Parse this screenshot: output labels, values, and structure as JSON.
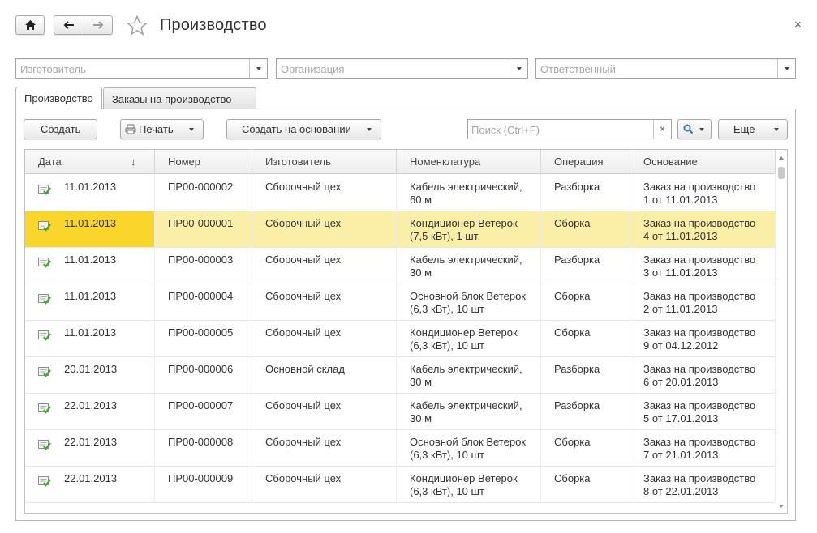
{
  "window": {
    "title": "Производство",
    "close_glyph": "×"
  },
  "icons": {
    "home": "home-icon",
    "back": "arrow-left-icon",
    "forward": "arrow-right-icon",
    "favorite": "star-icon",
    "print": "printer-icon",
    "search": "magnifier-icon",
    "doc": "posted-document-icon"
  },
  "filters": [
    {
      "placeholder": "Изготовитель"
    },
    {
      "placeholder": "Организация"
    },
    {
      "placeholder": "Ответственный"
    }
  ],
  "tabs": [
    {
      "label": "Производство",
      "active": true
    },
    {
      "label": "Заказы на производство",
      "active": false
    }
  ],
  "toolbar": {
    "create_label": "Создать",
    "print_label": "Печать",
    "create_based_label": "Создать на основании",
    "search_placeholder": "Поиск (Ctrl+F)",
    "search_clear": "×",
    "more_label": "Еще"
  },
  "colors": {
    "selected_row": "#fbeea6",
    "selected_cell": "#f9d72a",
    "doc_icon_check": "#3aa829"
  },
  "table": {
    "columns": [
      "Дата",
      "Номер",
      "Изготовитель",
      "Номенклатура",
      "Операция",
      "Основание"
    ],
    "sort_indicator": "↓",
    "selected_index": 1,
    "rows": [
      {
        "date": "11.01.2013",
        "number": "ПР00-000002",
        "maker": "Сборочный цех",
        "item1": "Кабель электрический,",
        "item2": "60 м",
        "operation": "Разборка",
        "basis1": "Заказ на производство",
        "basis2": "1 от 11.01.2013"
      },
      {
        "date": "11.01.2013",
        "number": "ПР00-000001",
        "maker": "Сборочный цех",
        "item1": "Кондиционер Ветерок",
        "item2": "(7,5 кВт), 1 шт",
        "operation": "Сборка",
        "basis1": "Заказ на производство",
        "basis2": "4 от 11.01.2013"
      },
      {
        "date": "11.01.2013",
        "number": "ПР00-000003",
        "maker": "Сборочный цех",
        "item1": "Кабель электрический,",
        "item2": "30 м",
        "operation": "Разборка",
        "basis1": "Заказ на производство",
        "basis2": "3 от 11.01.2013"
      },
      {
        "date": "11.01.2013",
        "number": "ПР00-000004",
        "maker": "Сборочный цех",
        "item1": "Основной блок Ветерок",
        "item2": "(6,3 кВт), 10 шт",
        "operation": "Сборка",
        "basis1": "Заказ на производство",
        "basis2": "2 от 11.01.2013"
      },
      {
        "date": "11.01.2013",
        "number": "ПР00-000005",
        "maker": "Сборочный цех",
        "item1": "Кондиционер Ветерок",
        "item2": "(6,3 кВт), 10 шт",
        "operation": "Сборка",
        "basis1": "Заказ на производство",
        "basis2": "9 от 04.12.2012"
      },
      {
        "date": "20.01.2013",
        "number": "ПР00-000006",
        "maker": "Основной склад",
        "item1": "Кабель электрический,",
        "item2": "30 м",
        "operation": "Разборка",
        "basis1": "Заказ на производство",
        "basis2": "6 от 20.01.2013"
      },
      {
        "date": "22.01.2013",
        "number": "ПР00-000007",
        "maker": "Сборочный цех",
        "item1": "Кабель электрический,",
        "item2": "30 м",
        "operation": "Разборка",
        "basis1": "Заказ на производство",
        "basis2": "5 от 17.01.2013"
      },
      {
        "date": "22.01.2013",
        "number": "ПР00-000008",
        "maker": "Сборочный цех",
        "item1": "Основной блок Ветерок",
        "item2": "(6,3 кВт), 10 шт",
        "operation": "Сборка",
        "basis1": "Заказ на производство",
        "basis2": "7 от 21.01.2013"
      },
      {
        "date": "22.01.2013",
        "number": "ПР00-000009",
        "maker": "Сборочный цех",
        "item1": "Кондиционер Ветерок",
        "item2": "(6,3 кВт), 10 шт",
        "operation": "Сборка",
        "basis1": "Заказ на производство",
        "basis2": "8 от 22.01.2013"
      }
    ]
  }
}
